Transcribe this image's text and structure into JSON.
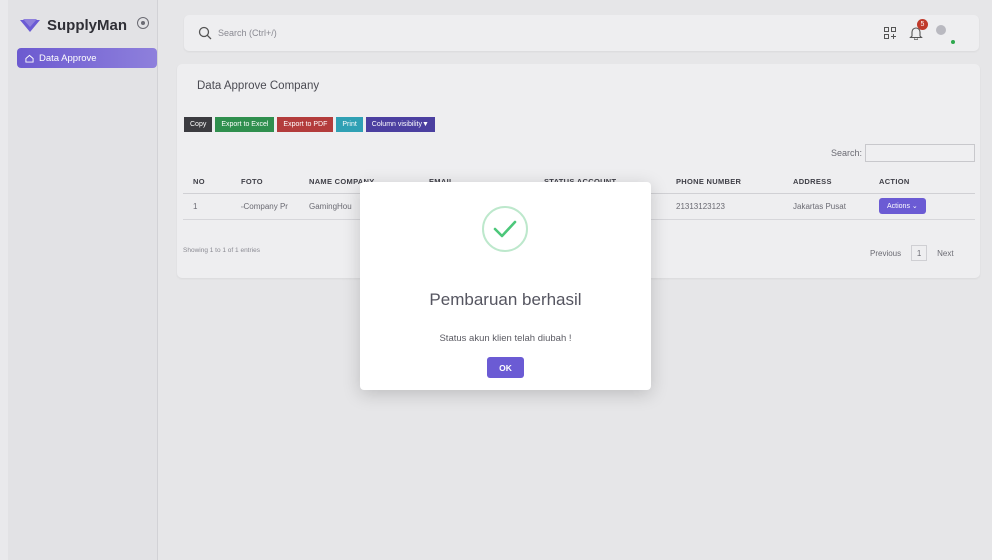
{
  "brand": {
    "name": "SupplyMan"
  },
  "sidebar": {
    "items": [
      {
        "label": "Data Approve",
        "icon": "home-icon"
      }
    ]
  },
  "topbar": {
    "search_placeholder": "Search (Ctrl+/)",
    "notification_count": "5"
  },
  "card": {
    "title": "Data Approve Company",
    "buttons": {
      "copy": "Copy",
      "excel": "Export to Excel",
      "pdf": "Export to PDF",
      "print": "Print",
      "colvis": "Column visibility▼"
    },
    "search_label": "Search:",
    "table": {
      "headers": [
        "NO",
        "FOTO",
        "NAME COMPANY",
        "EMAIL",
        "STATUS ACCOUNT",
        "PHONE NUMBER",
        "ADDRESS",
        "ACTION"
      ],
      "rows": [
        {
          "no": "1",
          "foto": "Company Pr",
          "name": "GamingHou",
          "email": "",
          "status": "",
          "phone": "21313123123",
          "address": "Jakartas Pusat",
          "action": "Actions"
        }
      ]
    },
    "showing": "Showing 1 to 1 of 1 entries",
    "pagination": {
      "previous": "Previous",
      "page": "1",
      "next": "Next"
    }
  },
  "modal": {
    "title": "Pembaruan berhasil",
    "text": "Status akun klien telah diubah !",
    "ok_label": "OK"
  },
  "colors": {
    "accent": "#6b5bd4",
    "success": "#4cc77a",
    "danger": "#b33c3c"
  }
}
